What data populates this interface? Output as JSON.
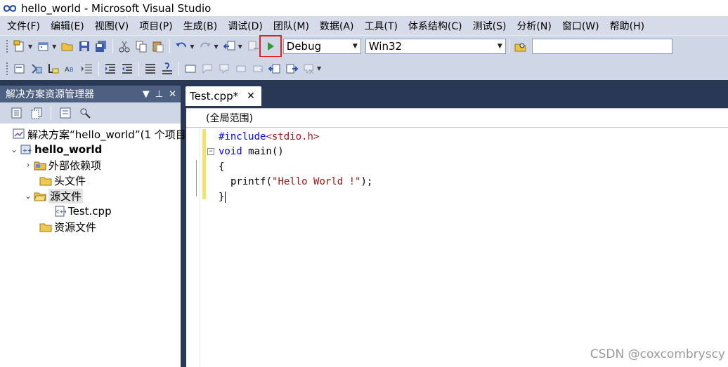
{
  "window": {
    "title": "hello_world - Microsoft Visual Studio",
    "logo_icon": "visual-studio-infinity-logo"
  },
  "menu": [
    "文件(F)",
    "编辑(E)",
    "视图(V)",
    "项目(P)",
    "生成(B)",
    "调试(D)",
    "团队(M)",
    "数据(A)",
    "工具(T)",
    "体系结构(C)",
    "测试(S)",
    "分析(N)",
    "窗口(W)",
    "帮助(H)"
  ],
  "toolbar": {
    "configuration": "Debug",
    "platform": "Win32",
    "start_debugging_highlight_color": "#e2231a",
    "search_value": ""
  },
  "solution_explorer": {
    "title": "解决方案资源管理器",
    "tree": [
      {
        "label": "解决方案“hello_world”(1 个项目",
        "level": 0,
        "icon": "solution-icon"
      },
      {
        "label": "hello_world",
        "level": 0,
        "icon": "cpp-project-icon",
        "expanded": true
      },
      {
        "label": "外部依赖项",
        "level": 1,
        "icon": "external-deps-icon",
        "expanded": false
      },
      {
        "label": "头文件",
        "level": 1,
        "icon": "folder-icon"
      },
      {
        "label": "源文件",
        "level": 1,
        "icon": "folder-open-icon",
        "expanded": true,
        "selected": true
      },
      {
        "label": "Test.cpp",
        "level": 2,
        "icon": "cpp-file-icon"
      },
      {
        "label": "资源文件",
        "level": 1,
        "icon": "folder-icon"
      }
    ]
  },
  "editor": {
    "tab_label": "Test.cpp*",
    "tab_close": "✕",
    "scope": "(全局范围)",
    "code": {
      "line1_directive": "#include",
      "line1_header": "<stdio.h>",
      "line2_kw": "void",
      "line2_rest": " main()",
      "line3": "{",
      "line4_fn": "printf(",
      "line4_str": "\"Hello World !\"",
      "line4_end": ");",
      "line5": "}"
    }
  },
  "watermark": "CSDN @coxcombryscy",
  "colors": {
    "menubar_bg": "#d6dbe9",
    "workarea_bg": "#293955",
    "panel_header_bg": "#4d6082",
    "keyword": "#0000ff",
    "string": "#a31515",
    "changebar": "#f2e36b"
  }
}
